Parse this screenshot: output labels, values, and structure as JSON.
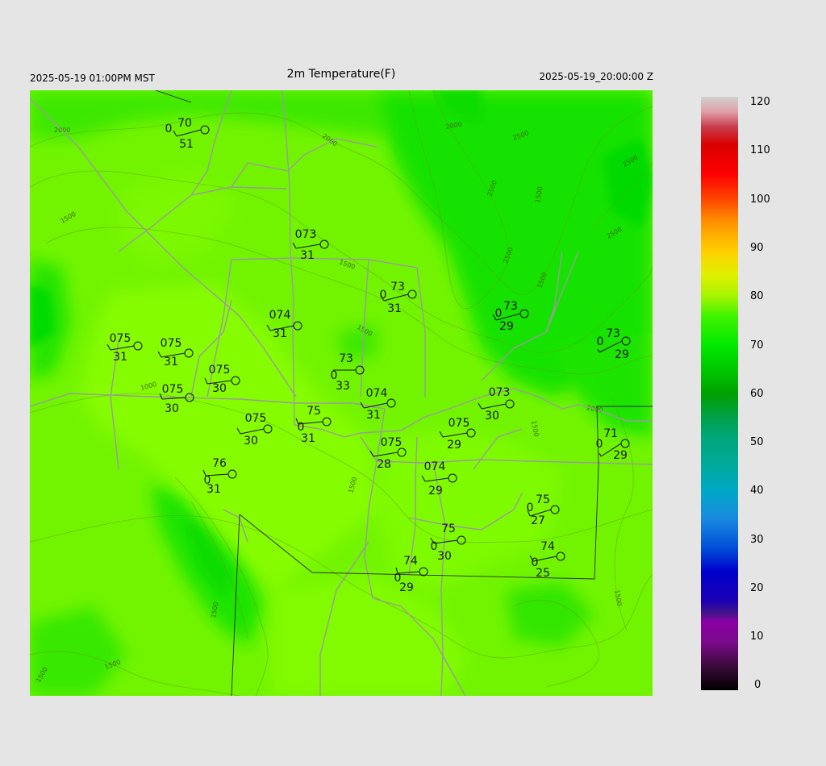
{
  "header": {
    "title": "2m Temperature(F)",
    "left_label": "2025-05-19 01:00PM MST",
    "right_label": "2025-05-19_20:00:00 Z"
  },
  "colorbar": {
    "ticks": [
      "120",
      "110",
      "100",
      "90",
      "80",
      "70",
      "60",
      "50",
      "40",
      "30",
      "20",
      "10",
      "0"
    ],
    "min": 0,
    "max": 120
  },
  "contour_labels": [
    "2000",
    "2000",
    "2000",
    "2500",
    "2500",
    "2500",
    "2500",
    "2500",
    "1500",
    "1500",
    "1500",
    "1500",
    "1500",
    "1500",
    "1500",
    "1500",
    "1000",
    "2000",
    "1500",
    "1500",
    "1500"
  ],
  "stations": [
    {
      "temp": "70",
      "dew": "51",
      "cloud": "0"
    },
    {
      "temp": "073",
      "dew": "31",
      "cloud": ""
    },
    {
      "temp": "73",
      "dew": "31",
      "cloud": "0"
    },
    {
      "temp": "73",
      "dew": "29",
      "cloud": "0"
    },
    {
      "temp": "73",
      "dew": "29",
      "cloud": "0"
    },
    {
      "temp": "075",
      "dew": "31",
      "cloud": ""
    },
    {
      "temp": "075",
      "dew": "31",
      "cloud": ""
    },
    {
      "temp": "074",
      "dew": "31",
      "cloud": ""
    },
    {
      "temp": "075",
      "dew": "30",
      "cloud": ""
    },
    {
      "temp": "73",
      "dew": "33",
      "cloud": "0"
    },
    {
      "temp": "075",
      "dew": "30",
      "cloud": ""
    },
    {
      "temp": "074",
      "dew": "31",
      "cloud": ""
    },
    {
      "temp": "073",
      "dew": "30",
      "cloud": ""
    },
    {
      "temp": "075",
      "dew": "30",
      "cloud": ""
    },
    {
      "temp": "75",
      "dew": "31",
      "cloud": "0"
    },
    {
      "temp": "075",
      "dew": "29",
      "cloud": ""
    },
    {
      "temp": "075",
      "dew": "28",
      "cloud": ""
    },
    {
      "temp": "71",
      "dew": "29",
      "cloud": "0"
    },
    {
      "temp": "76",
      "dew": "31",
      "cloud": "0"
    },
    {
      "temp": "074",
      "dew": "29",
      "cloud": ""
    },
    {
      "temp": "75",
      "dew": "27",
      "cloud": "0"
    },
    {
      "temp": "75",
      "dew": "30",
      "cloud": "0"
    },
    {
      "temp": "74",
      "dew": "25",
      "cloud": "0"
    },
    {
      "temp": "74",
      "dew": "29",
      "cloud": "0"
    }
  ],
  "colors": {
    "background": "#e5e5e5",
    "map_base": "#6cf200",
    "warm_zone": "#7efc00",
    "cool_zone": "#11e200",
    "road": "#9a9aa0"
  }
}
